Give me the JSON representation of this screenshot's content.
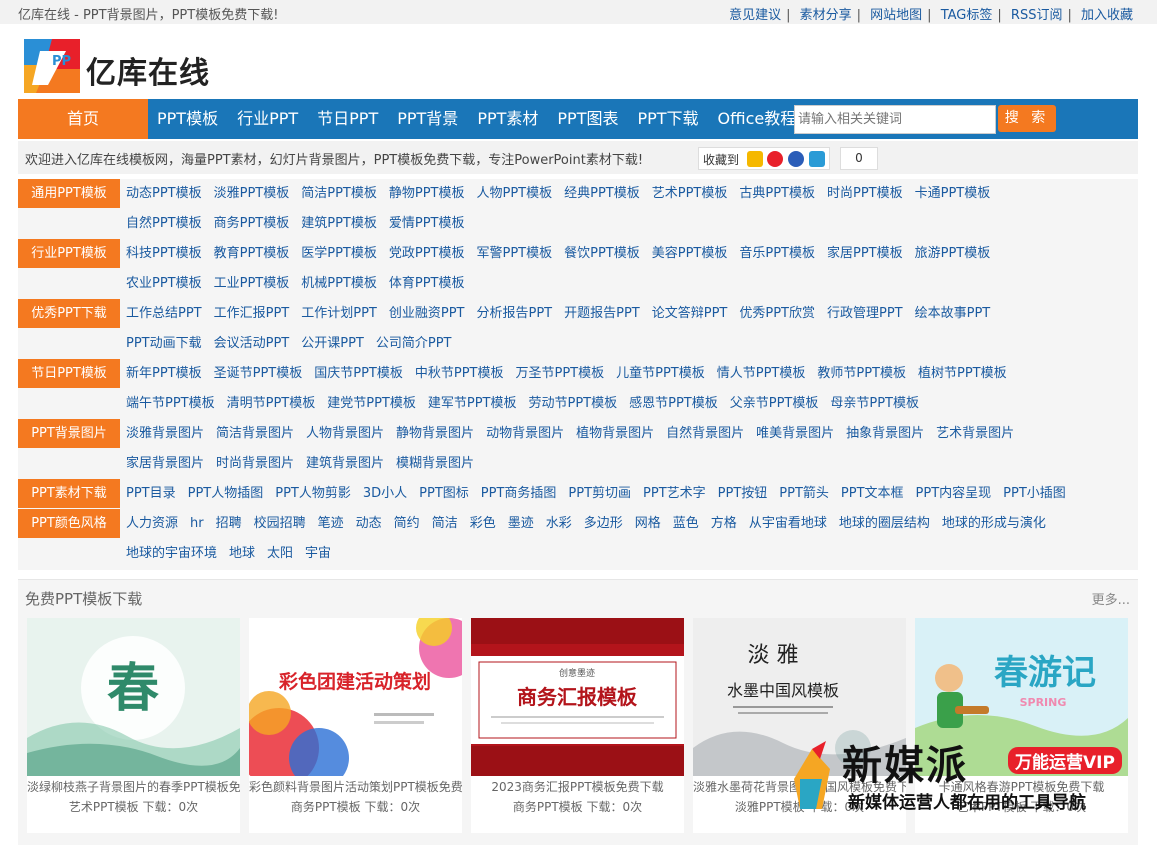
{
  "topbar": {
    "site_line": "亿库在线 - PPT背景图片，PPT模板免费下载!",
    "links": [
      "意见建议",
      "素材分享",
      "网站地图",
      "TAG标签",
      "RSS订阅",
      "加入收藏"
    ]
  },
  "logo": {
    "brand": "亿库在线",
    "mark_letters": "PP"
  },
  "nav": {
    "home": "首页",
    "items": [
      "PPT模板",
      "行业PPT",
      "节日PPT",
      "PPT背景",
      "PPT素材",
      "PPT图表",
      "PPT下载",
      "Office教程"
    ],
    "search_placeholder": "请输入相关关键词",
    "search_button": "搜 索"
  },
  "welcome": {
    "text": "欢迎进入亿库在线模板网，海量PPT素材，幻灯片背景图片，PPT模板免费下载，专注PowerPoint素材下载!",
    "fav_label": "收藏到",
    "fav_count": "0"
  },
  "categories": [
    {
      "label": "通用PPT模板",
      "rows": [
        [
          "动态PPT模板",
          "淡雅PPT模板",
          "简洁PPT模板",
          "静物PPT模板",
          "人物PPT模板",
          "经典PPT模板",
          "艺术PPT模板",
          "古典PPT模板",
          "时尚PPT模板",
          "卡通PPT模板"
        ],
        [
          "自然PPT模板",
          "商务PPT模板",
          "建筑PPT模板",
          "爱情PPT模板"
        ]
      ]
    },
    {
      "label": "行业PPT模板",
      "rows": [
        [
          "科技PPT模板",
          "教育PPT模板",
          "医学PPT模板",
          "党政PPT模板",
          "军警PPT模板",
          "餐饮PPT模板",
          "美容PPT模板",
          "音乐PPT模板",
          "家居PPT模板",
          "旅游PPT模板"
        ],
        [
          "农业PPT模板",
          "工业PPT模板",
          "机械PPT模板",
          "体育PPT模板"
        ]
      ]
    },
    {
      "label": "优秀PPT下载",
      "rows": [
        [
          "工作总结PPT",
          "工作汇报PPT",
          "工作计划PPT",
          "创业融资PPT",
          "分析报告PPT",
          "开题报告PPT",
          "论文答辩PPT",
          "优秀PPT欣赏",
          "行政管理PPT",
          "绘本故事PPT"
        ],
        [
          "PPT动画下载",
          "会议活动PPT",
          "公开课PPT",
          "公司简介PPT"
        ]
      ]
    },
    {
      "label": "节日PPT模板",
      "rows": [
        [
          "新年PPT模板",
          "圣诞节PPT模板",
          "国庆节PPT模板",
          "中秋节PPT模板",
          "万圣节PPT模板",
          "儿童节PPT模板",
          "情人节PPT模板",
          "教师节PPT模板",
          "植树节PPT模板"
        ],
        [
          "端午节PPT模板",
          "清明节PPT模板",
          "建党节PPT模板",
          "建军节PPT模板",
          "劳动节PPT模板",
          "感恩节PPT模板",
          "父亲节PPT模板",
          "母亲节PPT模板"
        ]
      ]
    },
    {
      "label": "PPT背景图片",
      "rows": [
        [
          "淡雅背景图片",
          "简洁背景图片",
          "人物背景图片",
          "静物背景图片",
          "动物背景图片",
          "植物背景图片",
          "自然背景图片",
          "唯美背景图片",
          "抽象背景图片",
          "艺术背景图片"
        ],
        [
          "家居背景图片",
          "时尚背景图片",
          "建筑背景图片",
          "模糊背景图片"
        ]
      ]
    },
    {
      "label": "PPT素材下载",
      "rows": [
        [
          "PPT目录",
          "PPT人物插图",
          "PPT人物剪影",
          "3D小人",
          "PPT图标",
          "PPT商务插图",
          "PPT剪切画",
          "PPT艺术字",
          "PPT按钮",
          "PPT箭头",
          "PPT文本框",
          "PPT内容呈现",
          "PPT小插图"
        ]
      ]
    },
    {
      "label": "PPT颜色风格",
      "rows": [
        [
          "人力资源",
          "hr",
          "招聘",
          "校园招聘",
          "笔迹",
          "动态",
          "简约",
          "简洁",
          "彩色",
          "墨迹",
          "水彩",
          "多边形",
          "网格",
          "蓝色",
          "方格",
          "从宇宙看地球",
          "地球的圈层结构",
          "地球的形成与演化"
        ],
        [
          "地球的宇宙环境",
          "地球",
          "太阳",
          "宇宙"
        ]
      ]
    }
  ],
  "section": {
    "title": "免费PPT模板下载",
    "more": "更多..."
  },
  "cards": [
    {
      "title": "淡绿柳枝燕子背景图片的春季PPT模板免",
      "meta": "艺术PPT模板  下载：0次",
      "thumb_text": "春",
      "colors": [
        "#e8f3ee",
        "#7cc3a5",
        "#2f8a6a"
      ]
    },
    {
      "title": "彩色颜料背景图片活动策划PPT模板免费",
      "meta": "商务PPT模板  下载：0次",
      "thumb_text": "彩色团建活动策划",
      "colors": [
        "#ffffff",
        "#d8232a",
        "#f5a623"
      ]
    },
    {
      "title": "2023商务汇报PPT模板免费下载",
      "meta": "商务PPT模板  下载：0次",
      "thumb_text": "商务汇报模板",
      "thumb_sub": "创意墨迹",
      "colors": [
        "#b3141b",
        "#ffffff",
        "#8a0e13"
      ]
    },
    {
      "title": "淡雅水墨荷花背景图片中国风模板免费下载",
      "meta": "淡雅PPT模板  下载：0次",
      "thumb_text": "水墨中国风模板",
      "thumb_sub": "淡  雅",
      "colors": [
        "#eeeeee",
        "#555555",
        "#9aa0a6"
      ]
    },
    {
      "title": "卡通风格春游PPT模板免费下载",
      "meta": "艺术PPT模板  下载：0次",
      "thumb_text": "春游记",
      "thumb_sub": "SPRING",
      "colors": [
        "#d9f1f7",
        "#2aa6c4",
        "#f08ab0"
      ]
    }
  ],
  "watermark": {
    "title": "新媒派",
    "badge": "万能运营VIP",
    "sub": "新媒体运营人都在用的工具导航"
  },
  "colors": {
    "orange": "#f47920",
    "blue": "#1a76b8",
    "link": "#1a5aa0"
  }
}
